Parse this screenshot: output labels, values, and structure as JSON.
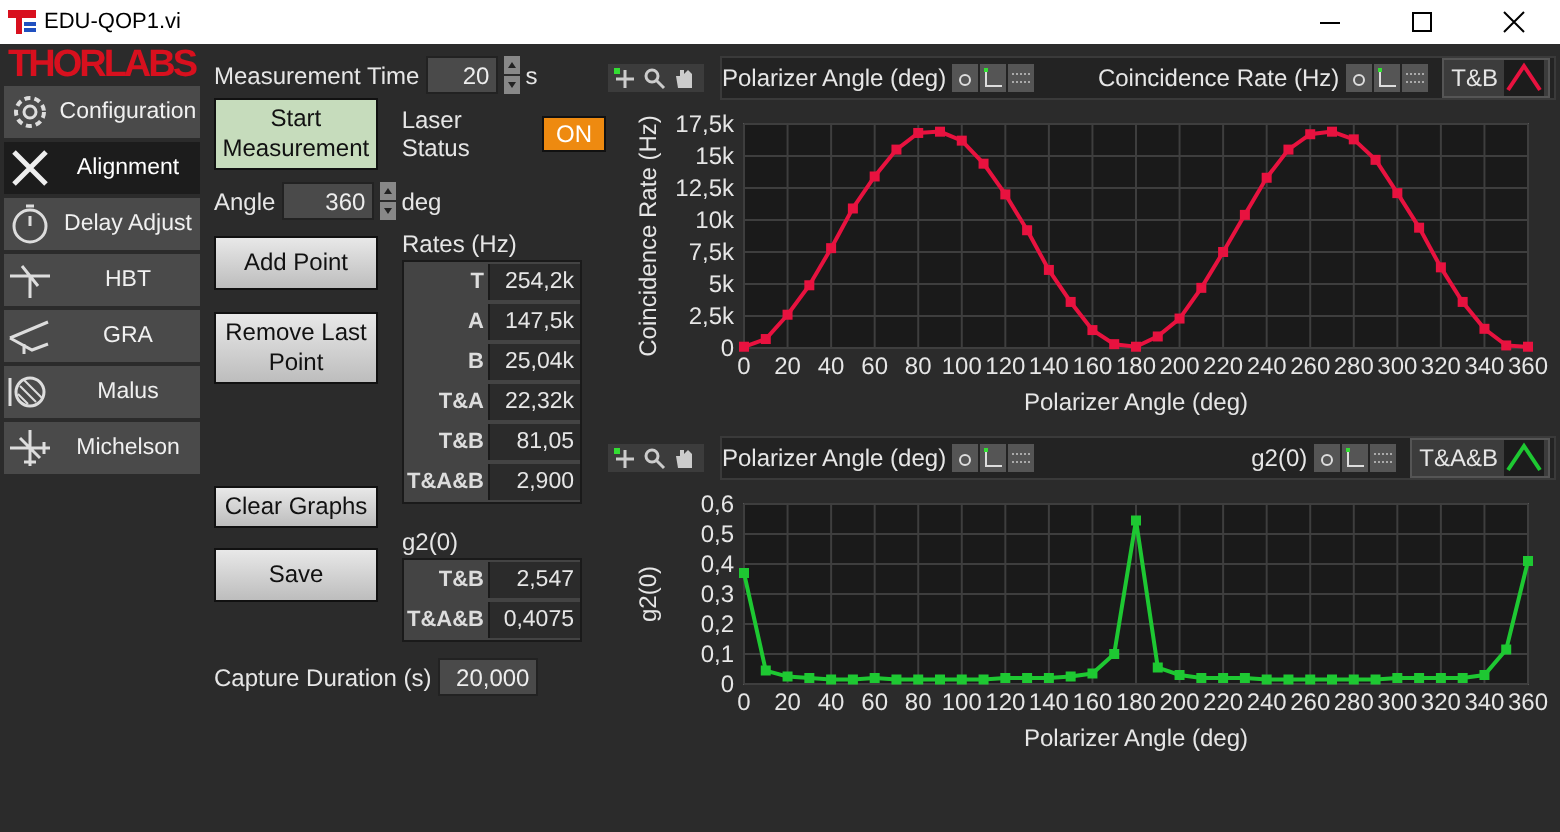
{
  "window": {
    "title": "EDU-QOP1.vi"
  },
  "sidebar": {
    "logo": "THORLABS",
    "items": [
      {
        "label": "Configuration",
        "selected": false
      },
      {
        "label": "Alignment",
        "selected": true
      },
      {
        "label": "Delay Adjust",
        "selected": false
      },
      {
        "label": "HBT",
        "selected": false
      },
      {
        "label": "GRA",
        "selected": false
      },
      {
        "label": "Malus",
        "selected": false
      },
      {
        "label": "Michelson",
        "selected": false
      }
    ]
  },
  "controls": {
    "measurement_time": {
      "label": "Measurement Time",
      "value": "20",
      "unit": "s"
    },
    "start_button": "Start Measurement",
    "laser_status": {
      "label": "Laser Status",
      "value": "ON",
      "on": true
    },
    "angle": {
      "label": "Angle",
      "value": "360",
      "unit": "deg"
    },
    "add_point_button": "Add Point",
    "remove_button": "Remove Last Point",
    "clear_button": "Clear Graphs",
    "save_button": "Save",
    "rates": {
      "title": "Rates (Hz)",
      "rows": [
        {
          "label": "T",
          "value": "254,2k"
        },
        {
          "label": "A",
          "value": "147,5k"
        },
        {
          "label": "B",
          "value": "25,04k"
        },
        {
          "label": "T&A",
          "value": "22,32k"
        },
        {
          "label": "T&B",
          "value": "81,05"
        },
        {
          "label": "T&A&B",
          "value": "2,900"
        }
      ]
    },
    "g2": {
      "title": "g2(0)",
      "rows": [
        {
          "label": "T&B",
          "value": "2,547"
        },
        {
          "label": "T&A&B",
          "value": "0,4075"
        }
      ]
    },
    "capture_duration": {
      "label": "Capture Duration (s)",
      "value": "20,000"
    }
  },
  "charts": [
    {
      "header": {
        "x_scale": "Polarizer Angle (deg)",
        "y_scale": "Coincidence Rate (Hz)"
      },
      "chart_data": {
        "type": "line",
        "xlabel": "Polarizer Angle (deg)",
        "ylabel": "Coincidence Rate (Hz)",
        "x": [
          0,
          10,
          20,
          30,
          40,
          50,
          60,
          70,
          80,
          90,
          100,
          110,
          120,
          130,
          140,
          150,
          160,
          170,
          180,
          190,
          200,
          210,
          220,
          230,
          240,
          250,
          260,
          270,
          280,
          290,
          300,
          310,
          320,
          330,
          340,
          350,
          360
        ],
        "grid": true,
        "series": [
          {
            "name": "T&B",
            "color": "#e8123f",
            "marker": true,
            "values": [
              100,
              700,
              2600,
              4900,
              7800,
              10900,
              13400,
              15500,
              16800,
              16900,
              16200,
              14400,
              12000,
              9200,
              6100,
              3600,
              1400,
              300,
              100,
              900,
              2300,
              4700,
              7500,
              10400,
              13300,
              15500,
              16700,
              16900,
              16300,
              14700,
              12100,
              9400,
              6300,
              3600,
              1500,
              200,
              100
            ]
          }
        ],
        "xlim": [
          0,
          360
        ],
        "ylim": [
          0,
          17500
        ],
        "xticks": [
          0,
          20,
          40,
          60,
          80,
          100,
          120,
          140,
          160,
          180,
          200,
          220,
          240,
          260,
          280,
          300,
          320,
          340,
          360
        ],
        "yticks": [
          {
            "value": 0,
            "label": "0"
          },
          {
            "value": 2500,
            "label": "2,5k"
          },
          {
            "value": 5000,
            "label": "5k"
          },
          {
            "value": 7500,
            "label": "7,5k"
          },
          {
            "value": 10000,
            "label": "10k"
          },
          {
            "value": 12500,
            "label": "12,5k"
          },
          {
            "value": 15000,
            "label": "15k"
          },
          {
            "value": 17500,
            "label": "17,5k"
          }
        ]
      }
    },
    {
      "header": {
        "x_scale": "Polarizer Angle (deg)",
        "y_scale": "g2(0)"
      },
      "chart_data": {
        "type": "line",
        "xlabel": "Polarizer Angle (deg)",
        "ylabel": "g2(0)",
        "x": [
          0,
          10,
          20,
          30,
          40,
          50,
          60,
          70,
          80,
          90,
          100,
          110,
          120,
          130,
          140,
          150,
          160,
          170,
          180,
          190,
          200,
          210,
          220,
          230,
          240,
          250,
          260,
          270,
          280,
          290,
          300,
          310,
          320,
          330,
          340,
          350,
          360
        ],
        "grid": true,
        "series": [
          {
            "name": "T&A&B",
            "color": "#1ec832",
            "marker": true,
            "values": [
              0.37,
              0.045,
              0.025,
              0.02,
              0.015,
              0.015,
              0.02,
              0.015,
              0.015,
              0.015,
              0.015,
              0.015,
              0.02,
              0.02,
              0.02,
              0.025,
              0.035,
              0.1,
              0.545,
              0.055,
              0.03,
              0.02,
              0.02,
              0.02,
              0.015,
              0.015,
              0.015,
              0.015,
              0.015,
              0.015,
              0.02,
              0.02,
              0.02,
              0.02,
              0.03,
              0.115,
              0.41
            ]
          }
        ],
        "xlim": [
          0,
          360
        ],
        "ylim": [
          0,
          0.6
        ],
        "xticks": [
          0,
          20,
          40,
          60,
          80,
          100,
          120,
          140,
          160,
          180,
          200,
          220,
          240,
          260,
          280,
          300,
          320,
          340,
          360
        ],
        "yticks": [
          {
            "value": 0,
            "label": "0"
          },
          {
            "value": 0.1,
            "label": "0,1"
          },
          {
            "value": 0.2,
            "label": "0,2"
          },
          {
            "value": 0.3,
            "label": "0,3"
          },
          {
            "value": 0.4,
            "label": "0,4"
          },
          {
            "value": 0.5,
            "label": "0,5"
          },
          {
            "value": 0.6,
            "label": "0,6"
          }
        ]
      }
    }
  ]
}
